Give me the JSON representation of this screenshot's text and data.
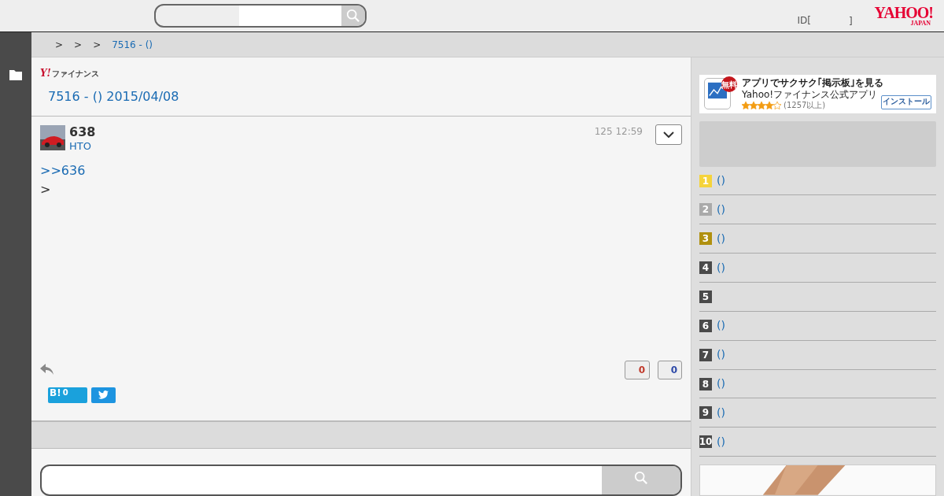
{
  "header": {
    "login": "ID[",
    "login_end": "]",
    "logo": "YAHOO!",
    "logo_sub": "JAPAN"
  },
  "breadcrumb": [
    ">",
    ">",
    ">",
    "7516 - ()"
  ],
  "board": {
    "brand": "Y!",
    "brand_text": "ファイナンス",
    "title": "7516 - () 2015/04/08"
  },
  "post": {
    "number": "638",
    "author": "HTO",
    "time": "125 12:59",
    "reply_to": ">>636",
    "body": ">",
    "likes": "0",
    "dislikes": "0",
    "hatena": "B!",
    "hatena_count": "0"
  },
  "ad": {
    "badge": "無料",
    "title": "アプリでサクサク｢掲示板｣を見る",
    "subtitle": "Yahoo!ファイナンス公式アプリ",
    "stars": 4,
    "reviews": "(1257以上)",
    "install": "インストール"
  },
  "ranking": [
    {
      "rank": "1",
      "color": "#f5d33b",
      "label": "()"
    },
    {
      "rank": "2",
      "color": "#aaaaaa",
      "label": "()"
    },
    {
      "rank": "3",
      "color": "#b0900f",
      "label": "()"
    },
    {
      "rank": "4",
      "color": "#4a4a4a",
      "label": "()"
    },
    {
      "rank": "5",
      "color": "#4a4a4a"
    },
    {
      "rank": "6",
      "color": "#4a4a4a",
      "label": "()"
    },
    {
      "rank": "7",
      "color": "#4a4a4a",
      "label": "()"
    },
    {
      "rank": "8",
      "color": "#4a4a4a",
      "label": "()"
    },
    {
      "rank": "9",
      "color": "#4a4a4a",
      "label": "()"
    },
    {
      "rank": "10",
      "color": "#4a4a4a",
      "label": "()"
    }
  ]
}
